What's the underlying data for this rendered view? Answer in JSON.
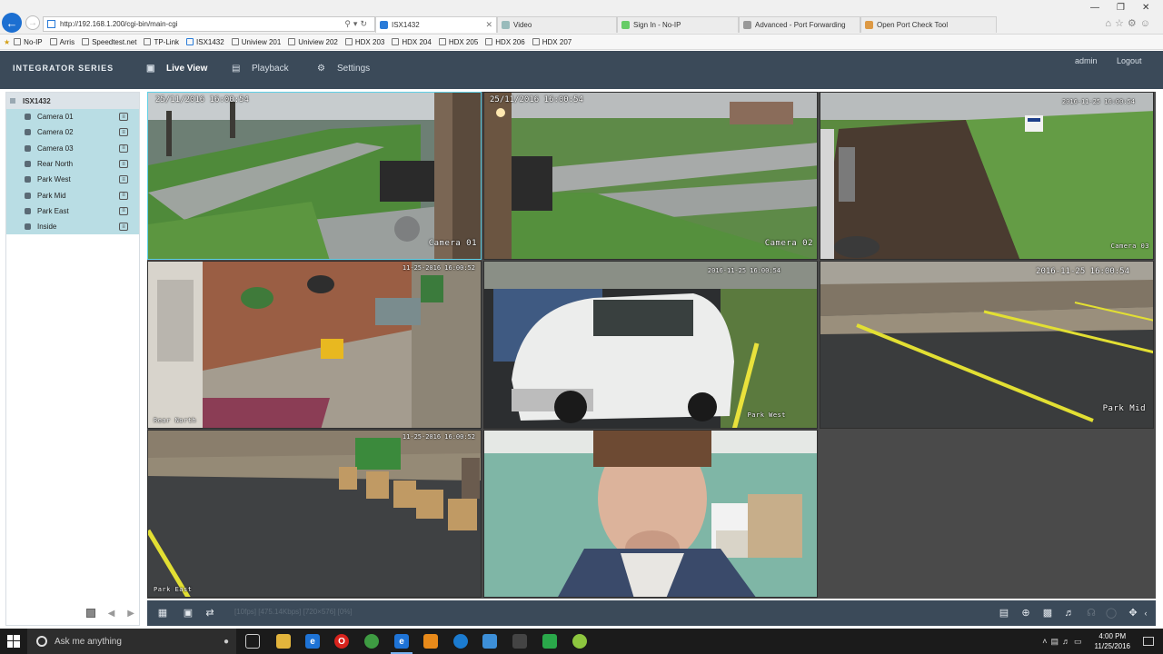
{
  "browser": {
    "url": "http://192.168.1.200/cgi-bin/main-cgi",
    "tabs": [
      {
        "label": "ISX1432",
        "active": true
      },
      {
        "label": "Video",
        "active": false
      },
      {
        "label": "Sign In - No-IP",
        "active": false
      },
      {
        "label": "Advanced - Port Forwarding",
        "active": false
      },
      {
        "label": "Open Port Check Tool",
        "active": false
      }
    ],
    "favorites": [
      "No-IP",
      "Arris",
      "Speedtest.net",
      "TP-Link",
      "ISX1432",
      "Uniview 201",
      "Uniview 202",
      "HDX 203",
      "HDX 204",
      "HDX 205",
      "HDX 206",
      "HDX 207"
    ]
  },
  "app": {
    "brand": "INTEGRATOR SERIES",
    "nav": [
      {
        "label": "Live View",
        "icon": "monitor-icon",
        "active": true
      },
      {
        "label": "Playback",
        "icon": "film-icon",
        "active": false
      },
      {
        "label": "Settings",
        "icon": "gear-icon",
        "active": false
      }
    ],
    "user": "admin",
    "logout": "Logout"
  },
  "sidebar": {
    "device": "ISX1432",
    "cameras": [
      "Camera 01",
      "Camera 02",
      "Camera 03",
      "Rear North",
      "Park West",
      "Park Mid",
      "Park East",
      "Inside"
    ]
  },
  "grid": {
    "cells": [
      {
        "title": "Camera 01",
        "timestamp": "25/11/2016 16:00:54",
        "selected": true
      },
      {
        "title": "Camera 02",
        "timestamp": "25/11/2016 16:00:54",
        "selected": false
      },
      {
        "title": "Camera 03",
        "timestamp": "2016-11-25 16:00:54",
        "selected": false
      },
      {
        "title": "Rear North",
        "timestamp": "11-25-2016 16:00:52",
        "selected": false
      },
      {
        "title": "Park West",
        "timestamp": "2016-11-25 16:00:54",
        "selected": false
      },
      {
        "title": "Park Mid",
        "timestamp": "2016-11-25 16:00:54",
        "selected": false
      },
      {
        "title": "Park East",
        "timestamp": "11-25-2016 16:00:52",
        "selected": false
      },
      {
        "title": "",
        "timestamp": "",
        "selected": false
      }
    ]
  },
  "toolbar": {
    "stream_info": "[10fps] [475.14Kbps] [720×576] [0%]"
  },
  "taskbar": {
    "search_placeholder": "Ask me anything",
    "time": "4:00 PM",
    "date": "11/25/2016"
  },
  "colors": {
    "app_header": "#3b4a59",
    "sidebar_selection": "#b9dde4",
    "back_button": "#1c6fd1"
  }
}
